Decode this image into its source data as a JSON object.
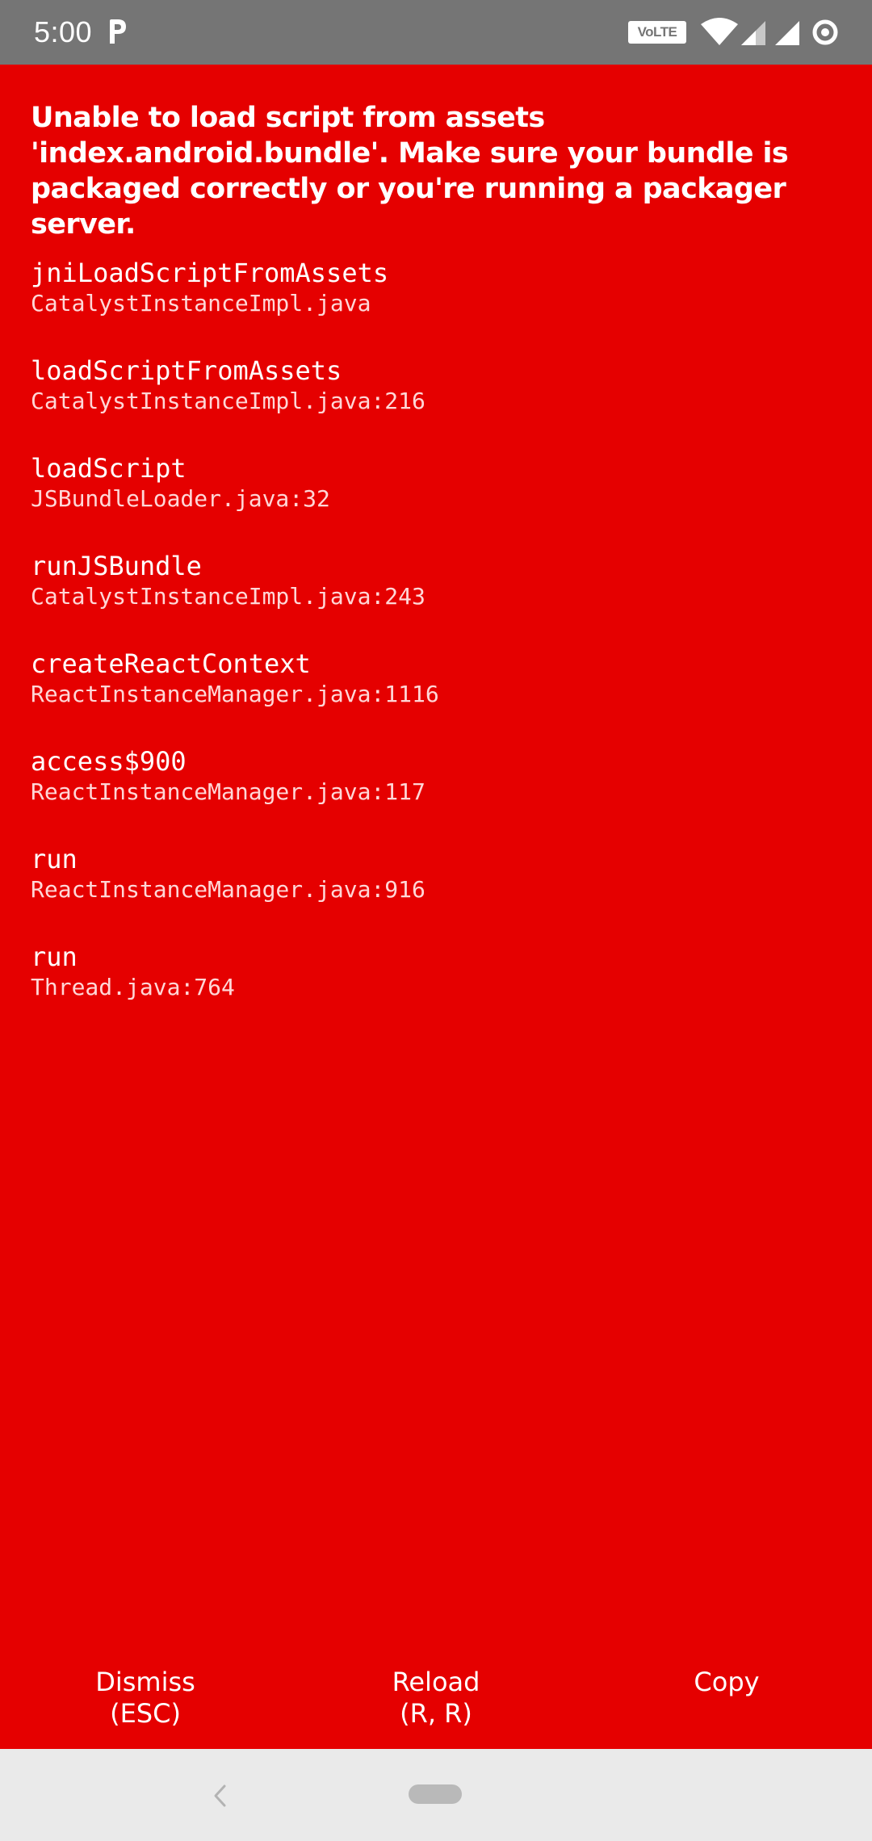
{
  "status_bar": {
    "time": "5:00",
    "volte_label": "VoLTE"
  },
  "error": {
    "message": "Unable to load script from assets 'index.android.bundle'. Make sure your bundle is packaged correctly or you're running a packager server."
  },
  "stack_trace": [
    {
      "method": "jniLoadScriptFromAssets",
      "file": "CatalystInstanceImpl.java"
    },
    {
      "method": "loadScriptFromAssets",
      "file": "CatalystInstanceImpl.java:216"
    },
    {
      "method": "loadScript",
      "file": "JSBundleLoader.java:32"
    },
    {
      "method": "runJSBundle",
      "file": "CatalystInstanceImpl.java:243"
    },
    {
      "method": "createReactContext",
      "file": "ReactInstanceManager.java:1116"
    },
    {
      "method": "access$900",
      "file": "ReactInstanceManager.java:117"
    },
    {
      "method": "run",
      "file": "ReactInstanceManager.java:916"
    },
    {
      "method": "run",
      "file": "Thread.java:764"
    }
  ],
  "actions": {
    "dismiss": {
      "label": "Dismiss",
      "shortcut": "(ESC)"
    },
    "reload": {
      "label": "Reload",
      "shortcut": "(R, R)"
    },
    "copy": {
      "label": "Copy"
    }
  },
  "colors": {
    "background": "#e50000",
    "status_bar": "#757575",
    "nav_bar": "#eaeaea"
  },
  "icons": {
    "status": [
      "parking-app-icon",
      "wifi-icon",
      "signal-icon",
      "signal-icon",
      "battery-saver-icon"
    ],
    "nav": [
      "back-icon",
      "home-pill-icon"
    ]
  }
}
